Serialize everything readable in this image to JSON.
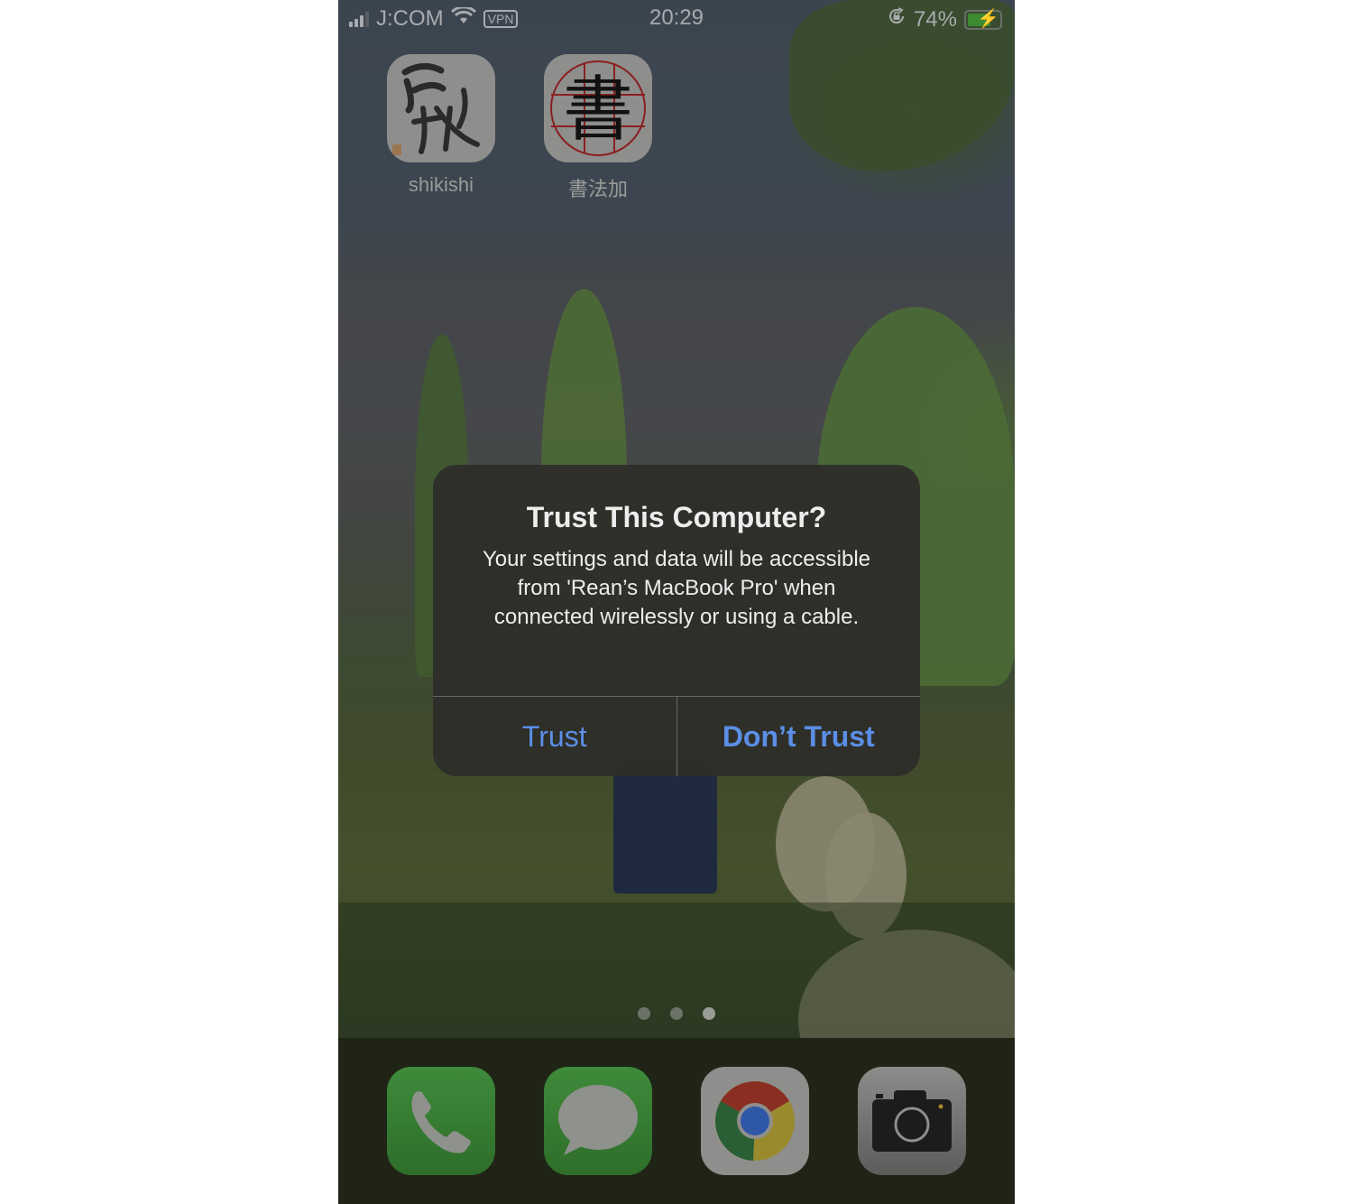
{
  "status_bar": {
    "carrier": "J:COM",
    "vpn_label": "VPN",
    "time": "20:29",
    "battery_percent_label": "74%",
    "battery_level": 0.74,
    "charging": true,
    "icons": [
      "signal-icon",
      "wifi-icon",
      "vpn-icon",
      "orientation-lock-icon",
      "battery-charging-icon"
    ]
  },
  "home_apps": [
    {
      "label": "shikishi",
      "icon": "shikishi-calligraphy-icon"
    },
    {
      "label": "書法加",
      "icon": "shufa-calligraphy-icon",
      "glyph": "書"
    }
  ],
  "alert": {
    "title": "Trust This Computer?",
    "message": "Your settings and data will be accessible from 'Rean’s MacBook Pro' when connected wirelessly or using a cable.",
    "buttons": [
      {
        "label": "Trust",
        "style": "default"
      },
      {
        "label": "Don’t Trust",
        "style": "bold"
      }
    ],
    "accent_color": "#5b8ee6"
  },
  "page_indicator": {
    "pages": 3,
    "current": 3
  },
  "dock": [
    {
      "name": "Phone",
      "icon": "phone-icon"
    },
    {
      "name": "Messages",
      "icon": "messages-icon"
    },
    {
      "name": "Chrome",
      "icon": "chrome-icon"
    },
    {
      "name": "Camera",
      "icon": "camera-icon"
    }
  ]
}
